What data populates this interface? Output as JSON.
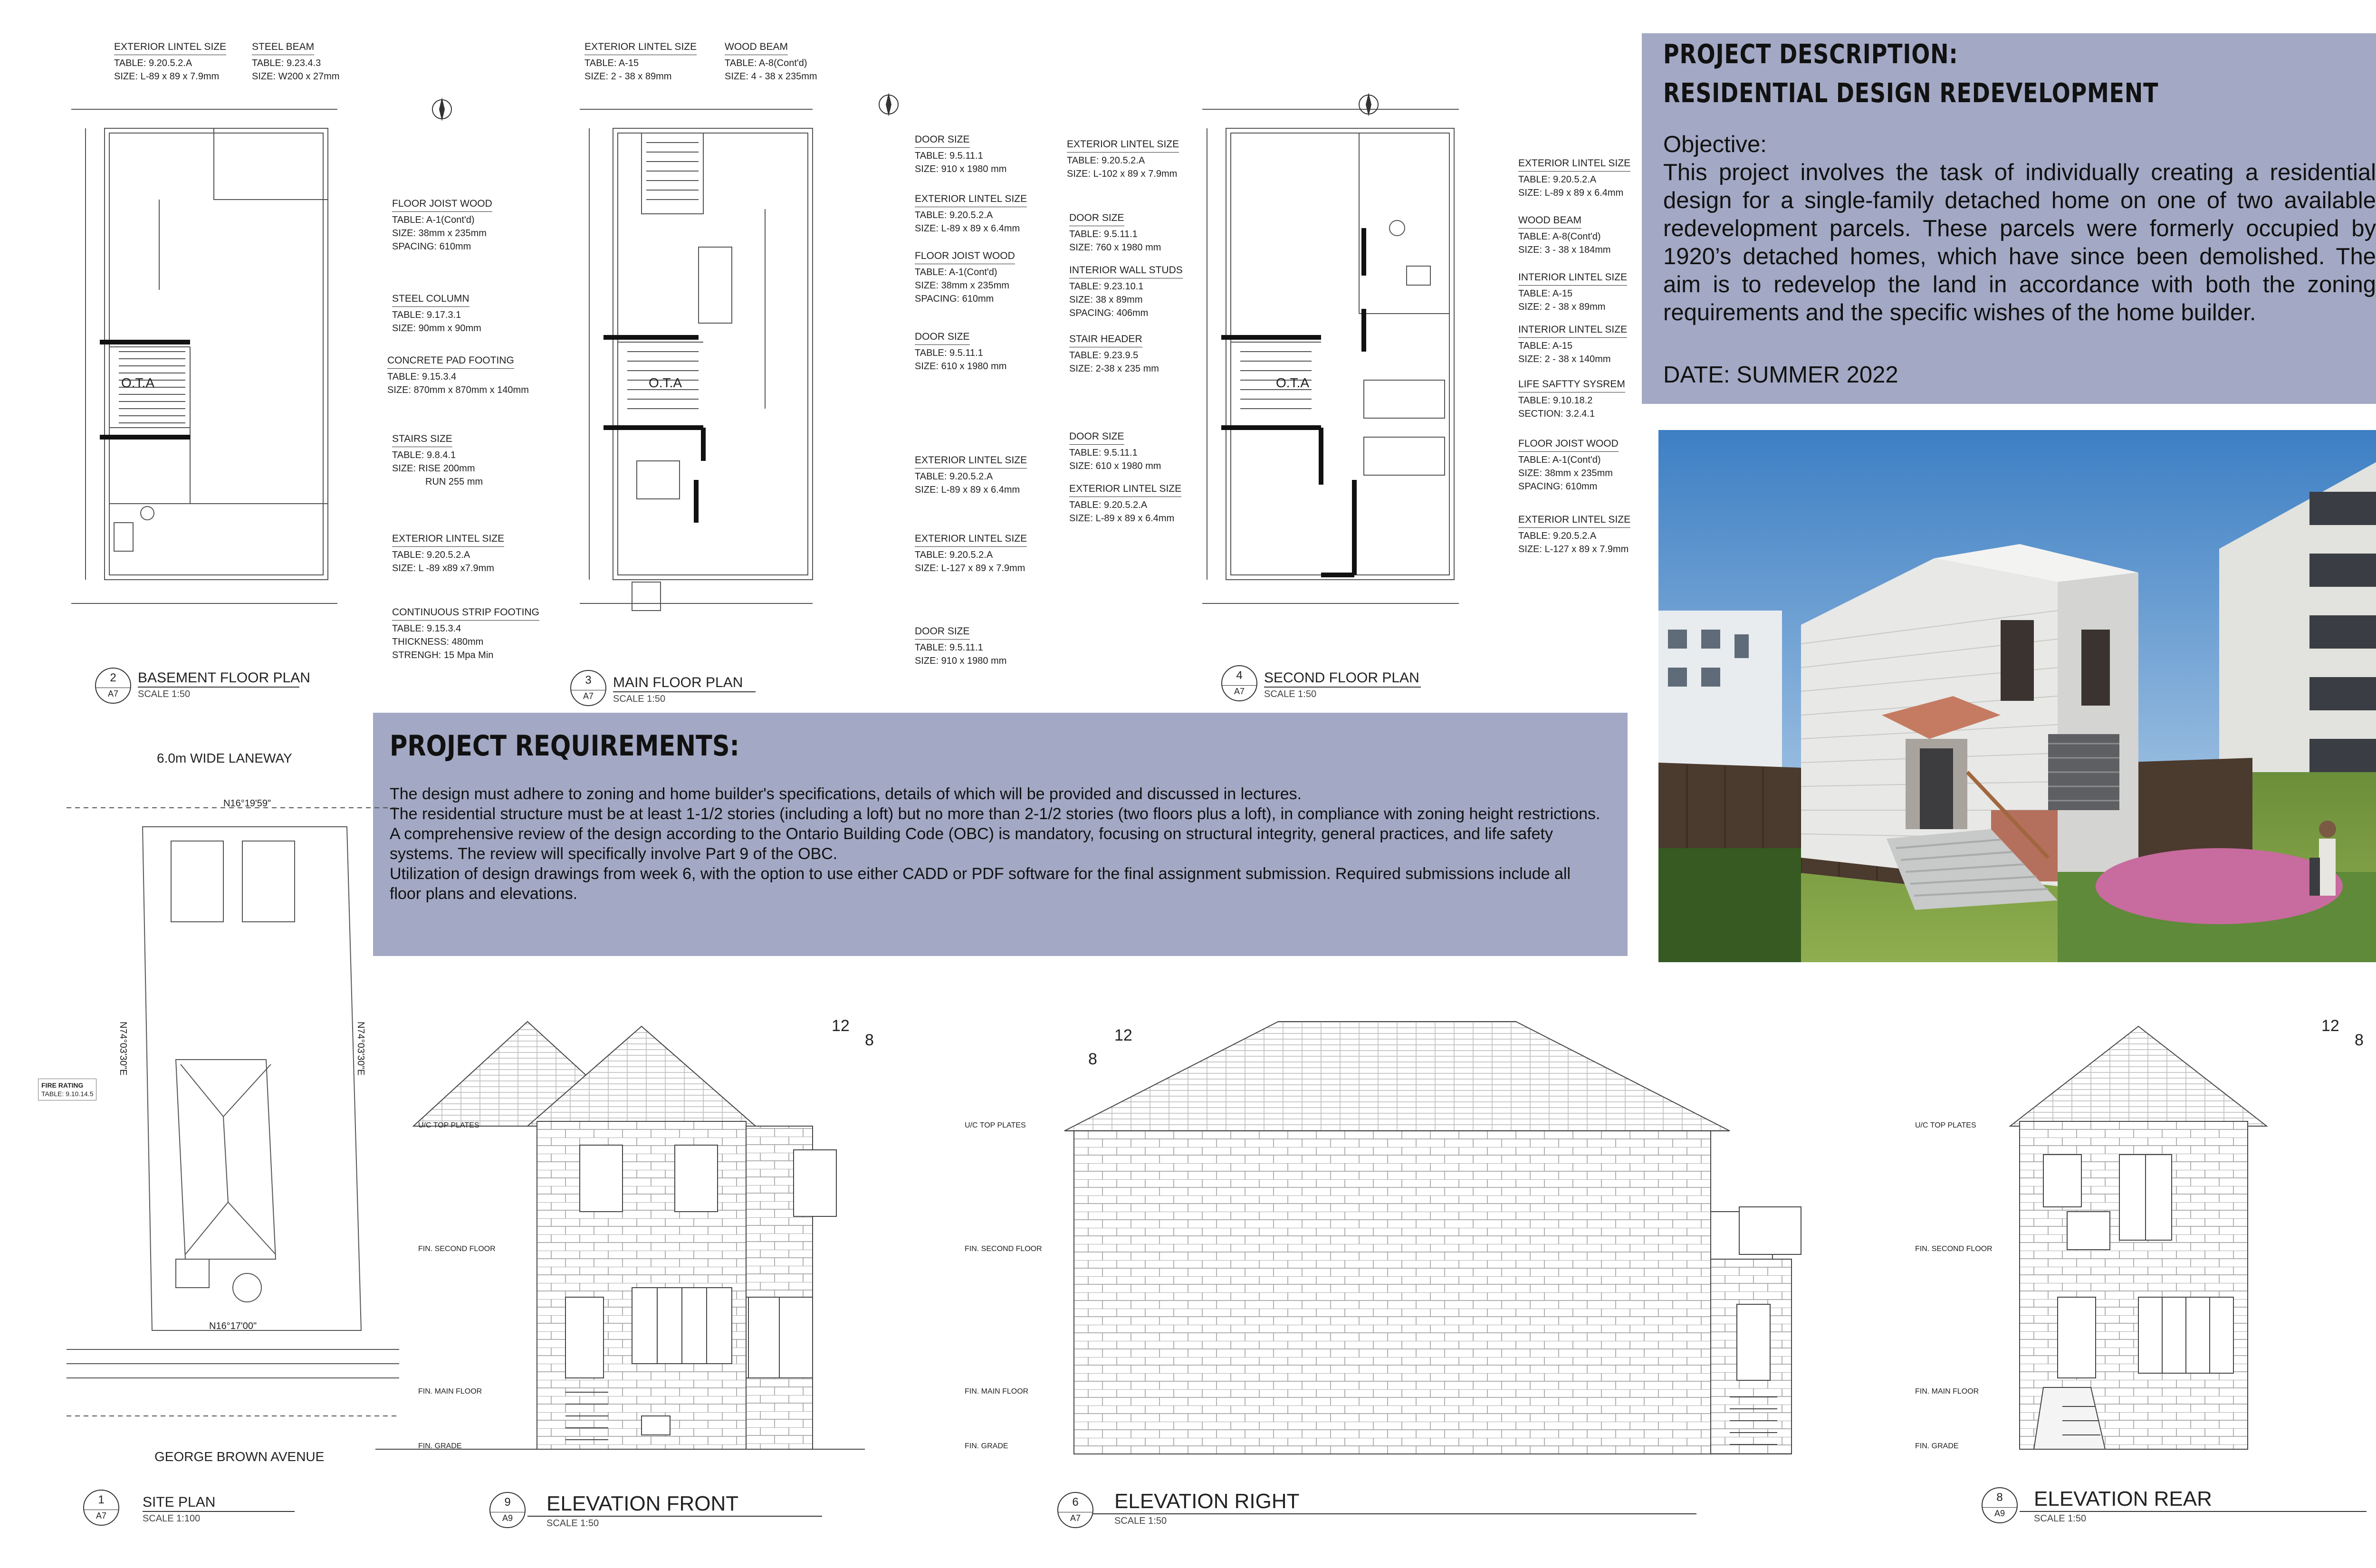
{
  "project_description": {
    "heading_line1": "PROJECT DESCRIPTION:",
    "heading_line2": "RESIDENTIAL DESIGN REDEVELOPMENT",
    "objective_label": "Objective:",
    "objective_text": "This project involves the task of individually creating a residential design for a single-family detached home on one of two available redevelopment parcels. These parcels were formerly occupied by 1920’s detached homes, which have since been demolished. The aim is to redevelop the land in accordance with both the zoning requirements and the specific wishes of the home builder.",
    "date": "DATE: SUMMER 2022"
  },
  "project_requirements": {
    "heading": "PROJECT REQUIREMENTS:",
    "items": [
      "The design must adhere to zoning and home builder's specifications, details of which will be provided and discussed in lectures.",
      "The residential structure must be at least 1-1/2 stories (including a loft) but no more than 2-1/2 stories (two floors plus a loft), in compliance with zoning height restrictions.",
      "A comprehensive review of the design according to the Ontario Building Code (OBC) is mandatory, focusing on structural integrity, general practices, and life safety systems. The review will specifically involve Part 9 of the OBC.",
      "Utilization of design drawings from week 6, with the option to use either CADD or PDF software for the final assignment submission. Required submissions include all floor plans and elevations."
    ]
  },
  "plans": {
    "basement": {
      "num": "2",
      "sheet": "A7",
      "title": "BASEMENT FLOOR PLAN",
      "scale": "SCALE 1:50",
      "ota": "O.T.A"
    },
    "main": {
      "num": "3",
      "sheet": "A7",
      "title": "MAIN FLOOR PLAN",
      "scale": "SCALE 1:50",
      "ota": "O.T.A"
    },
    "second": {
      "num": "4",
      "sheet": "A7",
      "title": "SECOND FLOOR PLAN",
      "scale": "SCALE 1:50",
      "ota": "O.T.A"
    }
  },
  "site": {
    "laneway": "6.0m WIDE LANEWAY",
    "avenue": "GEORGE BROWN AVENUE",
    "bearing_top": "N16°19'59\"",
    "bearing_bottom": "N16°17'00\"",
    "bearing_left": "N74°03'30\"E",
    "bearing_right": "N74°03'30\"E",
    "fire_rating_title": "FIRE RATING",
    "fire_rating_table": "TABLE: 9.10.14.5",
    "title": {
      "num": "1",
      "sheet": "A7",
      "title": "SITE PLAN",
      "scale": "SCALE 1:100"
    }
  },
  "elevations": {
    "front": {
      "num": "9",
      "sheet": "A9",
      "title": "ELEVATION FRONT",
      "scale": "SCALE 1:50",
      "pitch_run": "12",
      "pitch_rise": "8"
    },
    "right": {
      "num": "6",
      "sheet": "A7",
      "title": "ELEVATION RIGHT",
      "scale": "SCALE 1:50",
      "pitch_run": "12",
      "pitch_rise": "8"
    },
    "rear": {
      "num": "8",
      "sheet": "A9",
      "title": "ELEVATION REAR",
      "scale": "SCALE 1:50",
      "pitch_run": "12",
      "pitch_rise": "8"
    },
    "level_labels": {
      "top": "U/C TOP PLATES",
      "second": "FIN. SECOND FLOOR",
      "main": "FIN. MAIN FLOOR",
      "grade": "FIN. GRADE"
    }
  },
  "callouts": {
    "basement": [
      {
        "title": "EXTERIOR LINTEL SIZE",
        "lines": [
          "TABLE: 9.20.5.2.A",
          "SIZE: L-89 x 89 x 7.9mm"
        ]
      },
      {
        "title": "STEEL BEAM",
        "lines": [
          "TABLE: 9.23.4.3",
          "SIZE: W200 x 27mm"
        ]
      },
      {
        "title": "FLOOR JOIST WOOD",
        "lines": [
          "TABLE: A-1(Cont'd)",
          "SIZE: 38mm x 235mm",
          "SPACING: 610mm"
        ]
      },
      {
        "title": "STEEL COLUMN",
        "lines": [
          "TABLE: 9.17.3.1",
          "SIZE: 90mm x 90mm"
        ]
      },
      {
        "title": "CONCRETE PAD FOOTING",
        "lines": [
          "TABLE: 9.15.3.4",
          "SIZE: 870mm x 870mm x 140mm"
        ]
      },
      {
        "title": "STAIRS SIZE",
        "lines": [
          "TABLE: 9.8.4.1",
          "SIZE: RISE 200mm",
          "RUN 255 mm"
        ]
      },
      {
        "title": "EXTERIOR LINTEL SIZE",
        "lines": [
          "TABLE: 9.20.5.2.A",
          "SIZE: L -89 x89 x7.9mm"
        ]
      },
      {
        "title": "CONTINUOUS STRIP FOOTING",
        "lines": [
          "TABLE: 9.15.3.4",
          "THICKNESS: 480mm",
          "STRENGH: 15 Mpa Min"
        ]
      }
    ],
    "main": [
      {
        "title": "EXTERIOR LINTEL SIZE",
        "lines": [
          "TABLE: A-15",
          "SIZE: 2 - 38 x 89mm"
        ]
      },
      {
        "title": "WOOD BEAM",
        "lines": [
          "TABLE: A-8(Cont'd)",
          "SIZE: 4 - 38 x 235mm"
        ]
      },
      {
        "title": "DOOR SIZE",
        "lines": [
          "TABLE: 9.5.11.1",
          "SIZE: 910 x 1980 mm"
        ]
      },
      {
        "title": "EXTERIOR LINTEL SIZE",
        "lines": [
          "TABLE: 9.20.5.2.A",
          "SIZE: L-89 x 89 x 6.4mm"
        ]
      },
      {
        "title": "FLOOR JOIST WOOD",
        "lines": [
          "TABLE: A-1(Cont'd)",
          "SIZE: 38mm x 235mm",
          "SPACING: 610mm"
        ]
      },
      {
        "title": "DOOR SIZE",
        "lines": [
          "TABLE: 9.5.11.1",
          "SIZE: 610 x 1980 mm"
        ]
      },
      {
        "title": "EXTERIOR LINTEL SIZE",
        "lines": [
          "TABLE: 9.20.5.2.A",
          "SIZE: L-89 x 89 x 6.4mm"
        ]
      },
      {
        "title": "EXTERIOR LINTEL SIZE",
        "lines": [
          "TABLE: 9.20.5.2.A",
          "SIZE: L-127 x 89 x 7.9mm"
        ]
      },
      {
        "title": "DOOR SIZE",
        "lines": [
          "TABLE: 9.5.11.1",
          "SIZE: 910 x 1980 mm"
        ]
      }
    ],
    "second_left": [
      {
        "title": "EXTERIOR LINTEL SIZE",
        "lines": [
          "TABLE: 9.20.5.2.A",
          "SIZE: L-102 x 89 x 7.9mm"
        ]
      },
      {
        "title": "DOOR SIZE",
        "lines": [
          "TABLE: 9.5.11.1",
          "SIZE: 760 x 1980 mm"
        ]
      },
      {
        "title": "INTERIOR WALL STUDS",
        "lines": [
          "TABLE: 9.23.10.1",
          "SIZE: 38 x 89mm",
          "SPACING: 406mm"
        ]
      },
      {
        "title": "STAIR HEADER",
        "lines": [
          "TABLE: 9.23.9.5",
          "SIZE: 2-38 x 235 mm"
        ]
      },
      {
        "title": "DOOR SIZE",
        "lines": [
          "TABLE: 9.5.11.1",
          "SIZE: 610 x 1980 mm"
        ]
      },
      {
        "title": "EXTERIOR LINTEL SIZE",
        "lines": [
          "TABLE: 9.20.5.2.A",
          "SIZE: L-89 x 89 x 6.4mm"
        ]
      }
    ],
    "second_right": [
      {
        "title": "EXTERIOR LINTEL SIZE",
        "lines": [
          "TABLE: 9.20.5.2.A",
          "SIZE: L-89 x 89 x 6.4mm"
        ]
      },
      {
        "title": "WOOD BEAM",
        "lines": [
          "TABLE: A-8(Cont'd)",
          "SIZE: 3 - 38 x 184mm"
        ]
      },
      {
        "title": "INTERIOR LINTEL SIZE",
        "lines": [
          "TABLE: A-15",
          "SIZE: 2 - 38 x 89mm"
        ]
      },
      {
        "title": "INTERIOR LINTEL SIZE",
        "lines": [
          "TABLE: A-15",
          "SIZE: 2 - 38 x 140mm"
        ]
      },
      {
        "title": "LIFE SAFTTY SYSREM",
        "lines": [
          "TABLE: 9.10.18.2",
          "SECTION: 3.2.4.1"
        ]
      },
      {
        "title": "FLOOR JOIST WOOD",
        "lines": [
          "TABLE: A-1(Cont'd)",
          "SIZE: 38mm x 235mm",
          "SPACING: 610mm"
        ]
      },
      {
        "title": "EXTERIOR LINTEL SIZE",
        "lines": [
          "TABLE: 9.20.5.2.A",
          "SIZE: L-127 x 89 x 7.9mm"
        ]
      }
    ]
  }
}
